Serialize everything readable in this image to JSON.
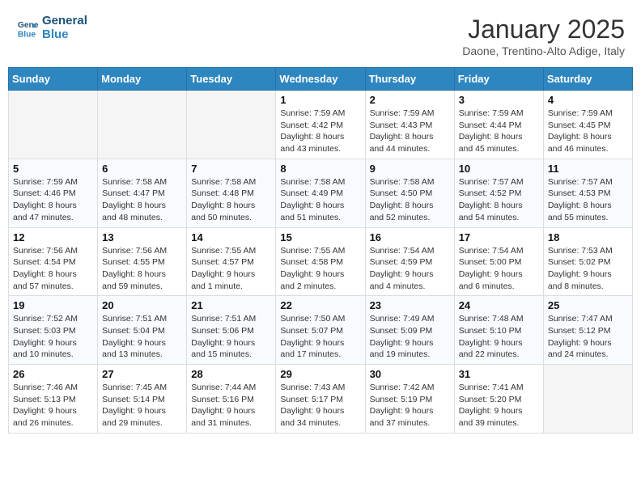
{
  "header": {
    "logo_line1": "General",
    "logo_line2": "Blue",
    "month": "January 2025",
    "location": "Daone, Trentino-Alto Adige, Italy"
  },
  "weekdays": [
    "Sunday",
    "Monday",
    "Tuesday",
    "Wednesday",
    "Thursday",
    "Friday",
    "Saturday"
  ],
  "weeks": [
    [
      {
        "day": "",
        "info": ""
      },
      {
        "day": "",
        "info": ""
      },
      {
        "day": "",
        "info": ""
      },
      {
        "day": "1",
        "info": "Sunrise: 7:59 AM\nSunset: 4:42 PM\nDaylight: 8 hours and 43 minutes."
      },
      {
        "day": "2",
        "info": "Sunrise: 7:59 AM\nSunset: 4:43 PM\nDaylight: 8 hours and 44 minutes."
      },
      {
        "day": "3",
        "info": "Sunrise: 7:59 AM\nSunset: 4:44 PM\nDaylight: 8 hours and 45 minutes."
      },
      {
        "day": "4",
        "info": "Sunrise: 7:59 AM\nSunset: 4:45 PM\nDaylight: 8 hours and 46 minutes."
      }
    ],
    [
      {
        "day": "5",
        "info": "Sunrise: 7:59 AM\nSunset: 4:46 PM\nDaylight: 8 hours and 47 minutes."
      },
      {
        "day": "6",
        "info": "Sunrise: 7:58 AM\nSunset: 4:47 PM\nDaylight: 8 hours and 48 minutes."
      },
      {
        "day": "7",
        "info": "Sunrise: 7:58 AM\nSunset: 4:48 PM\nDaylight: 8 hours and 50 minutes."
      },
      {
        "day": "8",
        "info": "Sunrise: 7:58 AM\nSunset: 4:49 PM\nDaylight: 8 hours and 51 minutes."
      },
      {
        "day": "9",
        "info": "Sunrise: 7:58 AM\nSunset: 4:50 PM\nDaylight: 8 hours and 52 minutes."
      },
      {
        "day": "10",
        "info": "Sunrise: 7:57 AM\nSunset: 4:52 PM\nDaylight: 8 hours and 54 minutes."
      },
      {
        "day": "11",
        "info": "Sunrise: 7:57 AM\nSunset: 4:53 PM\nDaylight: 8 hours and 55 minutes."
      }
    ],
    [
      {
        "day": "12",
        "info": "Sunrise: 7:56 AM\nSunset: 4:54 PM\nDaylight: 8 hours and 57 minutes."
      },
      {
        "day": "13",
        "info": "Sunrise: 7:56 AM\nSunset: 4:55 PM\nDaylight: 8 hours and 59 minutes."
      },
      {
        "day": "14",
        "info": "Sunrise: 7:55 AM\nSunset: 4:57 PM\nDaylight: 9 hours and 1 minute."
      },
      {
        "day": "15",
        "info": "Sunrise: 7:55 AM\nSunset: 4:58 PM\nDaylight: 9 hours and 2 minutes."
      },
      {
        "day": "16",
        "info": "Sunrise: 7:54 AM\nSunset: 4:59 PM\nDaylight: 9 hours and 4 minutes."
      },
      {
        "day": "17",
        "info": "Sunrise: 7:54 AM\nSunset: 5:00 PM\nDaylight: 9 hours and 6 minutes."
      },
      {
        "day": "18",
        "info": "Sunrise: 7:53 AM\nSunset: 5:02 PM\nDaylight: 9 hours and 8 minutes."
      }
    ],
    [
      {
        "day": "19",
        "info": "Sunrise: 7:52 AM\nSunset: 5:03 PM\nDaylight: 9 hours and 10 minutes."
      },
      {
        "day": "20",
        "info": "Sunrise: 7:51 AM\nSunset: 5:04 PM\nDaylight: 9 hours and 13 minutes."
      },
      {
        "day": "21",
        "info": "Sunrise: 7:51 AM\nSunset: 5:06 PM\nDaylight: 9 hours and 15 minutes."
      },
      {
        "day": "22",
        "info": "Sunrise: 7:50 AM\nSunset: 5:07 PM\nDaylight: 9 hours and 17 minutes."
      },
      {
        "day": "23",
        "info": "Sunrise: 7:49 AM\nSunset: 5:09 PM\nDaylight: 9 hours and 19 minutes."
      },
      {
        "day": "24",
        "info": "Sunrise: 7:48 AM\nSunset: 5:10 PM\nDaylight: 9 hours and 22 minutes."
      },
      {
        "day": "25",
        "info": "Sunrise: 7:47 AM\nSunset: 5:12 PM\nDaylight: 9 hours and 24 minutes."
      }
    ],
    [
      {
        "day": "26",
        "info": "Sunrise: 7:46 AM\nSunset: 5:13 PM\nDaylight: 9 hours and 26 minutes."
      },
      {
        "day": "27",
        "info": "Sunrise: 7:45 AM\nSunset: 5:14 PM\nDaylight: 9 hours and 29 minutes."
      },
      {
        "day": "28",
        "info": "Sunrise: 7:44 AM\nSunset: 5:16 PM\nDaylight: 9 hours and 31 minutes."
      },
      {
        "day": "29",
        "info": "Sunrise: 7:43 AM\nSunset: 5:17 PM\nDaylight: 9 hours and 34 minutes."
      },
      {
        "day": "30",
        "info": "Sunrise: 7:42 AM\nSunset: 5:19 PM\nDaylight: 9 hours and 37 minutes."
      },
      {
        "day": "31",
        "info": "Sunrise: 7:41 AM\nSunset: 5:20 PM\nDaylight: 9 hours and 39 minutes."
      },
      {
        "day": "",
        "info": ""
      }
    ]
  ]
}
